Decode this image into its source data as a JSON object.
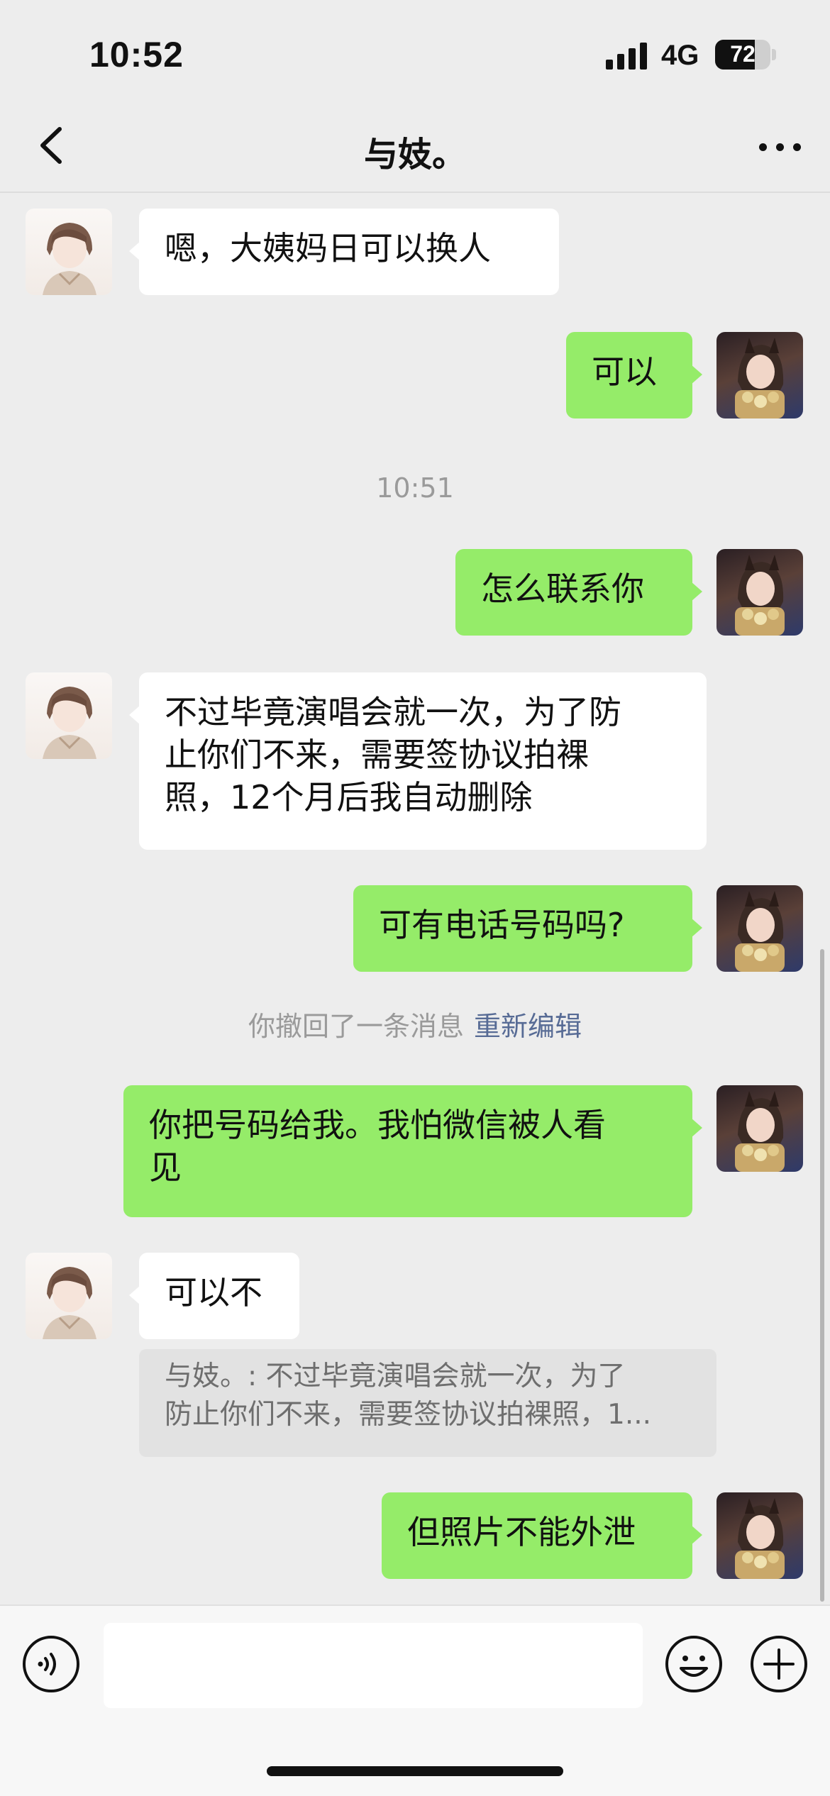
{
  "status_bar": {
    "time": "10:52",
    "network": "4G",
    "battery": "72",
    "battery_level": 0.72
  },
  "header": {
    "title": "与妓。",
    "back_icon": "chevron-left-icon",
    "more_icon": "ellipsis-icon"
  },
  "messages": [
    {
      "side": "left",
      "type": "text",
      "text": "嗯，大姨妈日可以换人"
    },
    {
      "side": "right",
      "type": "text",
      "text": "可以"
    },
    {
      "type": "timestamp",
      "text": "10:51"
    },
    {
      "side": "right",
      "type": "text",
      "text": "怎么联系你"
    },
    {
      "side": "left",
      "type": "text",
      "lines": [
        "不过毕竟演唱会就一次，为了防",
        "止你们不来，需要签协议拍裸",
        "照，12个月后我自动删除"
      ]
    },
    {
      "side": "right",
      "type": "text",
      "text": "可有电话号码吗?"
    },
    {
      "type": "recall",
      "text": "你撤回了一条消息",
      "action": "重新编辑"
    },
    {
      "side": "right",
      "type": "text",
      "lines": [
        "你把号码给我。我怕微信被人看",
        "见"
      ]
    },
    {
      "side": "left",
      "type": "text",
      "text": "可以不",
      "quote_lines": [
        "与妓。: 不过毕竟演唱会就一次，为了",
        "防止你们不来，需要签协议拍裸照，1..."
      ]
    },
    {
      "side": "right",
      "type": "text",
      "text": "但照片不能外泄"
    }
  ],
  "input_bar": {
    "voice_icon": "voice-icon",
    "emoji_icon": "emoji-icon",
    "plus_icon": "plus-icon",
    "input_value": ""
  },
  "colors": {
    "background": "#ededed",
    "sent_bubble": "#95ec69",
    "received_bubble": "#ffffff",
    "link": "#576b95"
  }
}
